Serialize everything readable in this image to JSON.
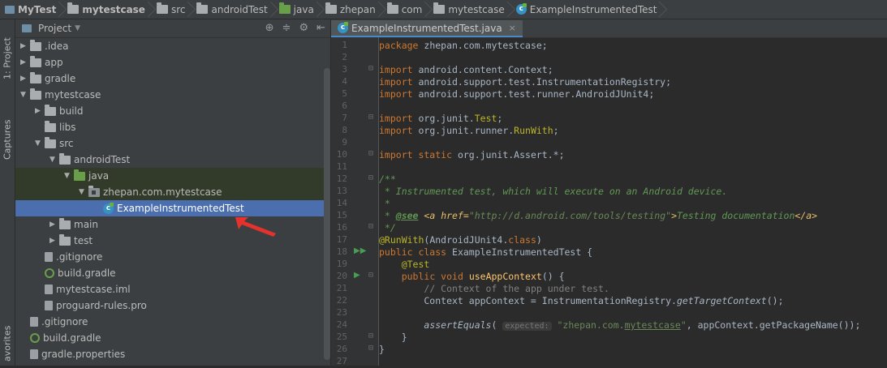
{
  "breadcrumbs": [
    "MyTest",
    "mytestcase",
    "src",
    "androidTest",
    "java",
    "zhepan",
    "com",
    "mytestcase",
    "ExampleInstrumentedTest"
  ],
  "left_strip": {
    "project_tab": "1: Project",
    "captures_tab": "Captures",
    "favorites_tab": "avorites"
  },
  "project_panel": {
    "title": "Project",
    "tree": [
      {
        "label": ".idea",
        "depth": 1,
        "arrow": "right",
        "icon": "folder"
      },
      {
        "label": "app",
        "depth": 1,
        "arrow": "right",
        "icon": "folder"
      },
      {
        "label": "gradle",
        "depth": 1,
        "arrow": "right",
        "icon": "folder"
      },
      {
        "label": "mytestcase",
        "depth": 1,
        "arrow": "down",
        "icon": "folder"
      },
      {
        "label": "build",
        "depth": 2,
        "arrow": "right",
        "icon": "folder"
      },
      {
        "label": "libs",
        "depth": 2,
        "arrow": "",
        "icon": "folder"
      },
      {
        "label": "src",
        "depth": 2,
        "arrow": "down",
        "icon": "folder"
      },
      {
        "label": "androidTest",
        "depth": 3,
        "arrow": "down",
        "icon": "folder"
      },
      {
        "label": "java",
        "depth": 4,
        "arrow": "down",
        "icon": "folder-green"
      },
      {
        "label": "zhepan.com.mytestcase",
        "depth": 5,
        "arrow": "down",
        "icon": "package"
      },
      {
        "label": "ExampleInstrumentedTest",
        "depth": 6,
        "arrow": "",
        "icon": "class"
      },
      {
        "label": "main",
        "depth": 3,
        "arrow": "right",
        "icon": "folder"
      },
      {
        "label": "test",
        "depth": 3,
        "arrow": "right",
        "icon": "folder"
      },
      {
        "label": ".gitignore",
        "depth": 2,
        "arrow": "",
        "icon": "file"
      },
      {
        "label": "build.gradle",
        "depth": 2,
        "arrow": "",
        "icon": "gradle"
      },
      {
        "label": "mytestcase.iml",
        "depth": 2,
        "arrow": "",
        "icon": "file"
      },
      {
        "label": "proguard-rules.pro",
        "depth": 2,
        "arrow": "",
        "icon": "file"
      },
      {
        "label": ".gitignore",
        "depth": 1,
        "arrow": "",
        "icon": "file"
      },
      {
        "label": "build.gradle",
        "depth": 1,
        "arrow": "",
        "icon": "gradle"
      },
      {
        "label": "gradle.properties",
        "depth": 1,
        "arrow": "",
        "icon": "file"
      }
    ]
  },
  "editor": {
    "tab_label": "ExampleInstrumentedTest.java",
    "line_numbers": [
      "1",
      "2",
      "3",
      "4",
      "5",
      "6",
      "7",
      "8",
      "9",
      "10",
      "11",
      "12",
      "13",
      "14",
      "15",
      "16",
      "17",
      "18",
      "19",
      "20",
      "21",
      "22",
      "23",
      "24",
      "25",
      "26",
      "27"
    ]
  }
}
